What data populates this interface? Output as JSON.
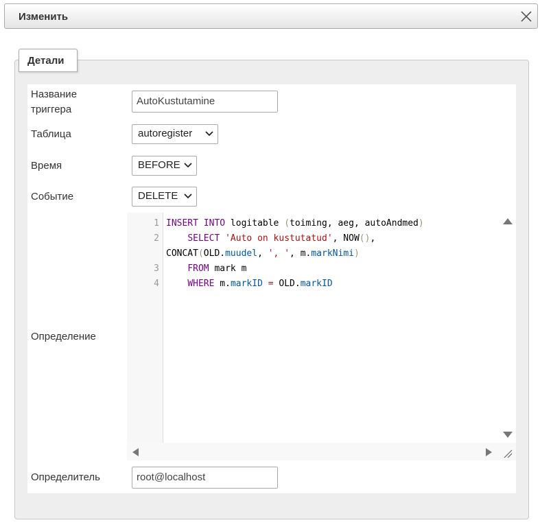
{
  "dialog": {
    "title": "Изменить",
    "close_icon": "close-icon"
  },
  "tabs": [
    {
      "label": "Детали",
      "active": true
    }
  ],
  "form": {
    "trigger_name": {
      "label_line1": "Название",
      "label_line2": "триггера",
      "value": "AutoKustutamine"
    },
    "table": {
      "label": "Таблица",
      "value": "autoregister"
    },
    "time": {
      "label": "Время",
      "value": "BEFORE"
    },
    "event": {
      "label": "Событие",
      "value": "DELETE"
    },
    "definition": {
      "label": "Определение",
      "line_numbers": [
        "1",
        "2",
        "3",
        "4"
      ],
      "code_lines": [
        "INSERT INTO logitable (toiming, aeg, autoAndmed)",
        "    SELECT 'Auto on kustutatud', NOW(),",
        "CONCAT(OLD.muudel, ', ', m.markNimi)",
        "    FROM mark m",
        "    WHERE m.markID = OLD.markID"
      ]
    },
    "definer": {
      "label": "Определитель",
      "value": "root@localhost"
    }
  },
  "colors": {
    "keyword": "#770088",
    "string": "#aa1111",
    "property": "#0055aa"
  }
}
